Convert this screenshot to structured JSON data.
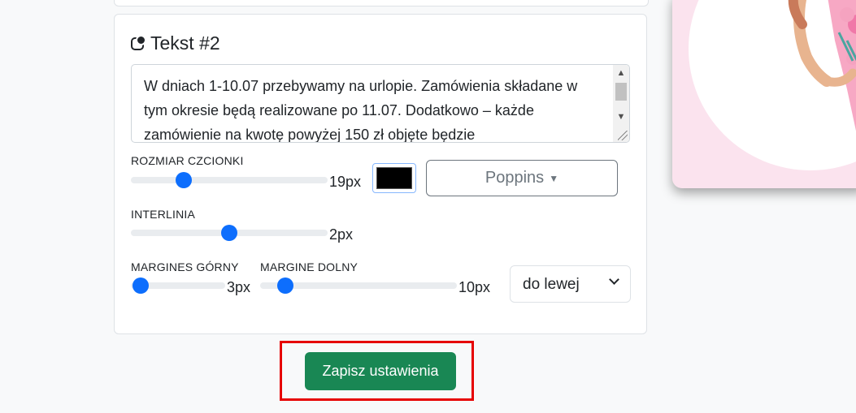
{
  "section": {
    "title": "Tekst #2",
    "text_value": "W dniach 1-10.07 przebywamy na urlopie. Zamówienia składane w tym okresie będą realizowane po 11.07. Dodatkowo – każde zamówienie na kwotę powyżej 150 zł objęte będzie"
  },
  "font_size": {
    "label": "ROZMIAR CZCIONKI",
    "value_text": "19px"
  },
  "color": {
    "value": "#000000"
  },
  "font_family": {
    "label": "Poppins"
  },
  "line_height": {
    "label": "INTERLINIA",
    "value_text": "2px"
  },
  "margin_top": {
    "label": "MARGINES GÓRNY",
    "value_text": "3px"
  },
  "margin_bottom": {
    "label": "MARGINE DOLNY",
    "value_text": "10px"
  },
  "alignment": {
    "selected": "do lewej"
  },
  "save_button": {
    "label": "Zapisz ustawienia",
    "color": "#198754"
  },
  "colors": {
    "slider": "#0d6efd",
    "highlight": "#e60000"
  }
}
